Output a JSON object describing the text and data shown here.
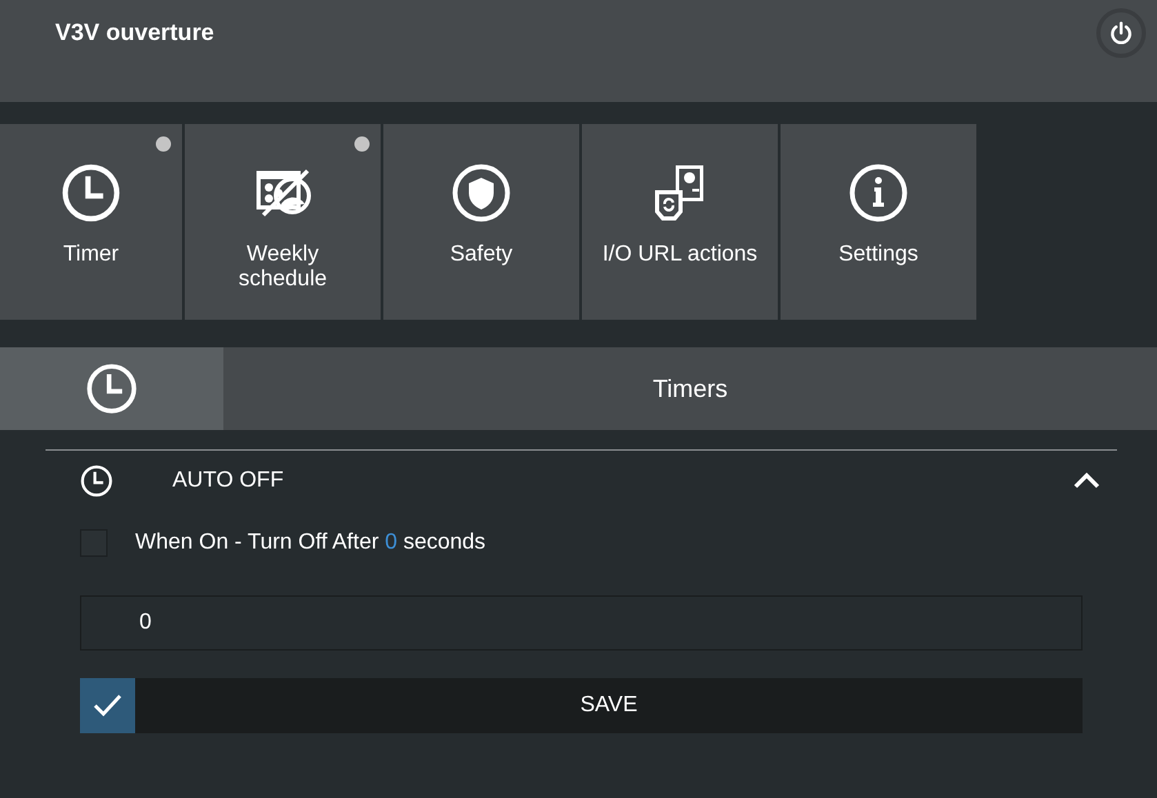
{
  "header": {
    "title": "V3V ouverture"
  },
  "tiles": [
    {
      "label": "Timer",
      "indicator": true
    },
    {
      "label": "Weekly schedule",
      "indicator": true
    },
    {
      "label": "Safety",
      "indicator": false
    },
    {
      "label": "I/O URL actions",
      "indicator": false
    },
    {
      "label": "Settings",
      "indicator": false
    }
  ],
  "tabs": [
    {
      "kind": "icon",
      "selected": true
    },
    {
      "kind": "text",
      "label": "Timers",
      "selected": false
    }
  ],
  "section": {
    "title": "AUTO OFF",
    "expanded": true,
    "option": {
      "checked": false,
      "text_before": "When On - Turn Off After",
      "value": "0",
      "text_after": "seconds"
    },
    "input": {
      "value": "0"
    },
    "save": {
      "label": "SAVE"
    }
  }
}
